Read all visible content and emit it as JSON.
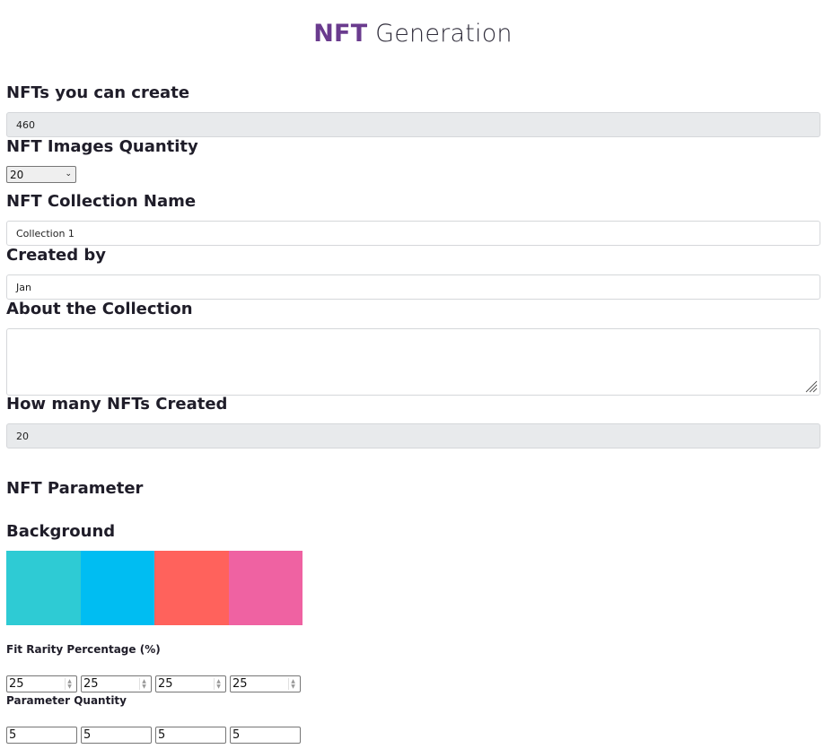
{
  "header": {
    "title_accent": "NFT",
    "title_rest": "Generation"
  },
  "form": {
    "nfts_can_create": {
      "label": "NFTs you can create",
      "value": "460"
    },
    "images_quantity": {
      "label": "NFT Images Quantity",
      "selected": "20"
    },
    "collection_name": {
      "label": "NFT Collection Name",
      "value": "Collection 1"
    },
    "created_by": {
      "label": "Created by",
      "value": "Jan"
    },
    "about": {
      "label": "About the Collection",
      "value": ""
    },
    "how_many_created": {
      "label": "How many NFTs Created",
      "value": "20"
    }
  },
  "parameters": {
    "section_title": "NFT Parameter",
    "background": {
      "label": "Background",
      "colors": [
        "#2ecbd4",
        "#00bdf2",
        "#ff625c",
        "#ef62a2"
      ],
      "rarity_label": "Fit Rarity Percentage (%)",
      "rarity_values": [
        "25",
        "25",
        "25",
        "25"
      ],
      "quantity_label": "Parameter Quantity",
      "quantity_values": [
        "5",
        "5",
        "5",
        "5"
      ]
    }
  }
}
